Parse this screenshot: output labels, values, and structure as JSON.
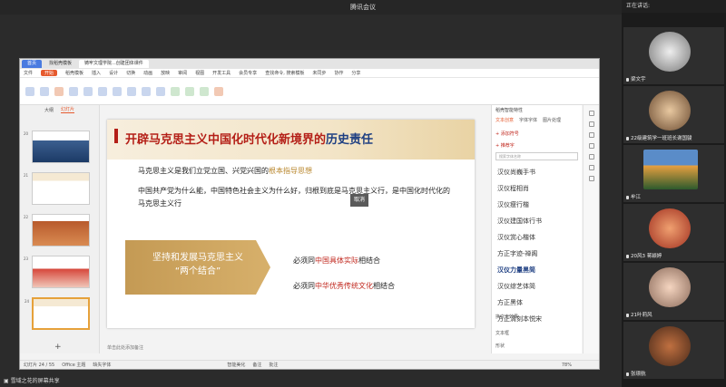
{
  "window": {
    "title": "腾讯会议"
  },
  "wps": {
    "tabs": [
      "首页",
      "找稻壳模板",
      "铸牢文理学院...创建团体课件"
    ],
    "menu": [
      "开始",
      "插入",
      "设计",
      "切换",
      "动画",
      "放映",
      "审阅",
      "视图",
      "开发工具",
      "会员专享"
    ],
    "menu_extra": [
      "文件",
      "稻壳模板",
      "查找命令, 搜索模板",
      "未同步",
      "协作",
      "分享"
    ],
    "left_tabs": [
      "大纲",
      "幻灯片"
    ],
    "slide_numbers": [
      "20",
      "21",
      "22",
      "23",
      "24"
    ],
    "notes_placeholder": "单击此处添加备注",
    "status": {
      "page": "幻灯片 24 / 55",
      "theme": "Office 主题",
      "font": "缺失字体",
      "smart": "智能美化",
      "notes": "备注",
      "comment": "批注",
      "zoom": "78%"
    }
  },
  "slide": {
    "title_main": "开辟马克思主义中国化时代化新境界的",
    "title_accent": "历史责任",
    "line1_a": "马克思主义是我们立党立国、兴党兴国的",
    "line1_b": "根本指导思想",
    "line2": "中国共产党为什么能，中国特色社会主义为什么好，归根到底是马克思主义行，是中国化时代化的马克思主义行",
    "tooltip": "取消",
    "banner_line1": "坚持和发展马克思主义",
    "banner_line2": "“两个结合”",
    "row1_a": "必须同",
    "row1_b": "中国具体实际",
    "row1_c": "相结合",
    "row2_a": "必须同",
    "row2_b": "中华优秀传统文化",
    "row2_c": "相结合"
  },
  "rightpane": {
    "title": "稻壳智能特性",
    "tabs": [
      "文本创意",
      "字体字体",
      "图片处理"
    ],
    "section1": "+ 添加符号",
    "section2": "+ 推荐字",
    "search_placeholder": "搜索字体名称",
    "fonts": [
      "汉仪尚巍手书",
      "汉仪程相肖",
      "汉仪瘦行楷",
      "汉仪建国体行书",
      "汉仪赏心楷体",
      "方正字迹-禅阁",
      "汉仪力量黑简",
      "汉仪综艺体简",
      "方正黑体",
      "方正清刻本悦宋"
    ],
    "bottom": [
      "换文本效果",
      "文本框",
      "形状"
    ]
  },
  "share_label": "雪域之花的屏幕共享",
  "speaking_label": "正在讲话:",
  "participants": [
    "梁文宇",
    "22级建筑学一班班长谢国骏",
    "牟江",
    "20风3 蒋颖婷",
    "21叶莉风",
    "张璟航"
  ]
}
